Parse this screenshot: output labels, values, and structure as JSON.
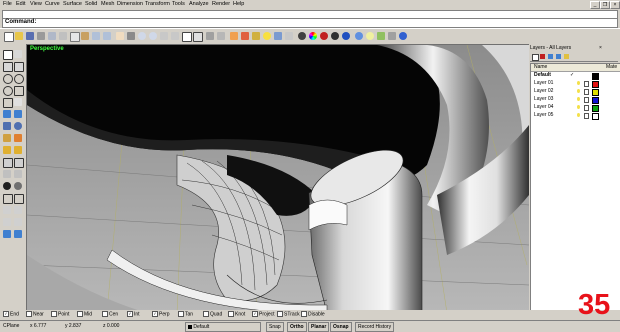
{
  "menu": [
    "File",
    "Edit",
    "View",
    "Curve",
    "Surface",
    "Solid",
    "Mesh",
    "Dimension",
    "Transform",
    "Tools",
    "Analyze",
    "Render",
    "Help"
  ],
  "command": {
    "label": "Command:"
  },
  "viewport": {
    "title": "Perspective"
  },
  "layers": {
    "title": "Layers - All Layers",
    "columns": [
      "Name",
      "Mate"
    ],
    "rows": [
      {
        "name": "Default",
        "color": "#000000",
        "current": true
      },
      {
        "name": "Layer 01",
        "color": "#e01010"
      },
      {
        "name": "Layer 02",
        "color": "#e0e000"
      },
      {
        "name": "Layer 03",
        "color": "#1010d0"
      },
      {
        "name": "Layer 04",
        "color": "#10a010"
      },
      {
        "name": "Layer 05",
        "color": "#ffffff"
      }
    ]
  },
  "osnap": [
    {
      "label": "End",
      "checked": true
    },
    {
      "label": "Near",
      "checked": false
    },
    {
      "label": "Point",
      "checked": false
    },
    {
      "label": "Mid",
      "checked": false
    },
    {
      "label": "Cen",
      "checked": false
    },
    {
      "label": "Int",
      "checked": true
    },
    {
      "label": "Perp",
      "checked": true
    },
    {
      "label": "Tan",
      "checked": false
    },
    {
      "label": "Quad",
      "checked": false
    },
    {
      "label": "Knot",
      "checked": false
    },
    {
      "label": "Project",
      "checked": true
    },
    {
      "label": "STrack",
      "checked": false
    },
    {
      "label": "Disable",
      "checked": false
    }
  ],
  "status": {
    "cplane": "CPlane",
    "x": "x 6.777",
    "y": "y 2.837",
    "z": "z 0.000",
    "layer": "Default",
    "snap": "Snap",
    "ortho": "Ortho",
    "planar": "Planar",
    "osnap": "Osnap",
    "history": "Record History"
  },
  "badge": "35"
}
